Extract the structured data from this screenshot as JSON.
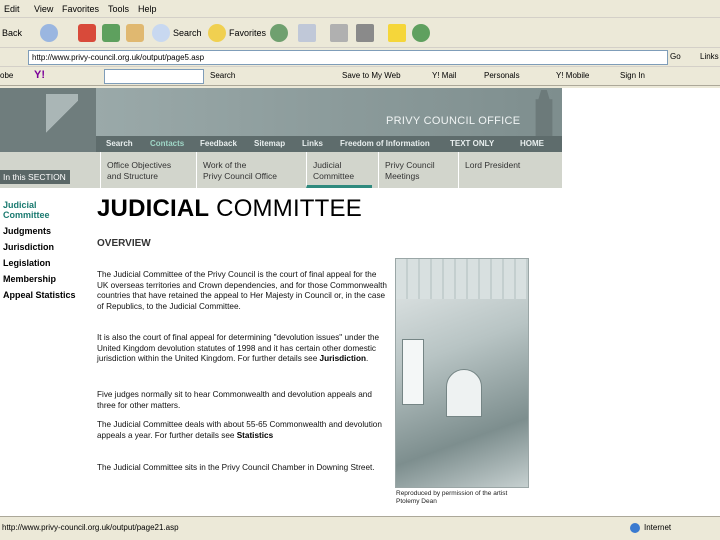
{
  "browser": {
    "menu": [
      "Edit",
      "View",
      "Favorites",
      "Tools",
      "Help"
    ],
    "toolbar": {
      "back": "Back",
      "search": "Search",
      "favorites": "Favorites"
    },
    "address": "http://www.privy-council.org.uk/output/page5.asp",
    "go": "Go",
    "links": "Links",
    "yahoo": {
      "label": "Y!",
      "search": "Search",
      "save": "Save to My Web",
      "mail": "Y! Mail",
      "personals": "Personals",
      "mobile": "Y! Mobile",
      "signin": "Sign In",
      "prefix": "obe"
    },
    "status": {
      "url": "http://www.privy-council.org.uk/output/page21.asp",
      "zone": "Internet"
    }
  },
  "site": {
    "title": "PRIVY COUNCIL OFFICE",
    "nav": [
      "Search",
      "Contacts",
      "Feedback",
      "Sitemap",
      "Links",
      "Freedom of Information",
      "TEXT ONLY",
      "HOME"
    ],
    "section_label": "In this SECTION",
    "subnav": [
      {
        "line1": "Office Objectives",
        "line2": "and Structure"
      },
      {
        "line1": "Work of the",
        "line2": "Privy Council Office"
      },
      {
        "line1": "Judicial",
        "line2": "Committee"
      },
      {
        "line1": "Privy Council",
        "line2": "Meetings"
      },
      {
        "line1": "Lord President",
        "line2": ""
      }
    ],
    "sidebar": [
      {
        "label": "Judicial Committee"
      },
      {
        "label": "Judgments"
      },
      {
        "label": "Jurisdiction"
      },
      {
        "label": "Legislation"
      },
      {
        "label": "Membership"
      },
      {
        "label": "Appeal Statistics"
      }
    ]
  },
  "content": {
    "heading_bold": "JUDICIAL",
    "heading_rest": "COMMITTEE",
    "overview": "OVERVIEW",
    "p1": "The Judicial Committee of the Privy Council is the court of final appeal for the UK overseas territories and Crown dependencies, and for those Commonwealth countries that have retained the appeal to Her Majesty in Council or, in the case of Republics, to the Judicial Committee.",
    "p2a": "It is also the court of final appeal for determining \"devolution issues\" under the United Kingdom devolution statutes of 1998 and it has certain other domestic jurisdiction within the United Kingdom. For further details see ",
    "p2_link": "Jurisdiction",
    "p2b": ".",
    "p3": "Five judges normally sit to hear Commonwealth and devolution appeals and three for other matters.",
    "p4a": "The Judicial Committee deals with about 55-65 Commonwealth and devolution appeals a year. For further details see ",
    "p4_link": "Statistics",
    "p5": "The Judicial Committee sits in the Privy Council Chamber in Downing Street.",
    "caption": "Reproduced by permission of the artist Ptolemy Dean"
  }
}
